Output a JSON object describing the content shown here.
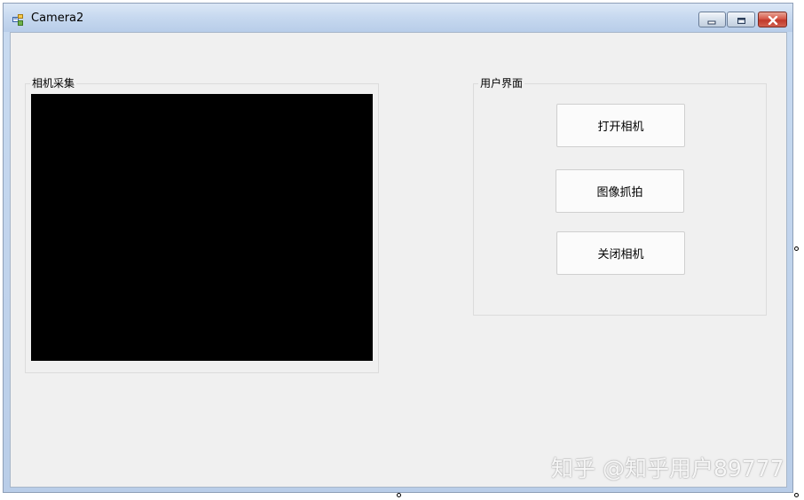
{
  "window": {
    "title": "Camera2",
    "icon": "app-forms-icon",
    "controls": [
      "minimize-icon",
      "restore-icon",
      "close-icon"
    ]
  },
  "camera_group": {
    "label": "相机采集"
  },
  "user_group": {
    "label": "用户界面",
    "buttons": {
      "open": "打开相机",
      "capture": "图像抓拍",
      "close": "关闭相机"
    }
  },
  "watermark": {
    "text": "知乎 @知乎用户89777"
  },
  "colors": {
    "client_bg": "#f0f0f0",
    "title_bar": "#c6d8ef",
    "video_bg": "#000000",
    "close_button": "#c0392b"
  }
}
